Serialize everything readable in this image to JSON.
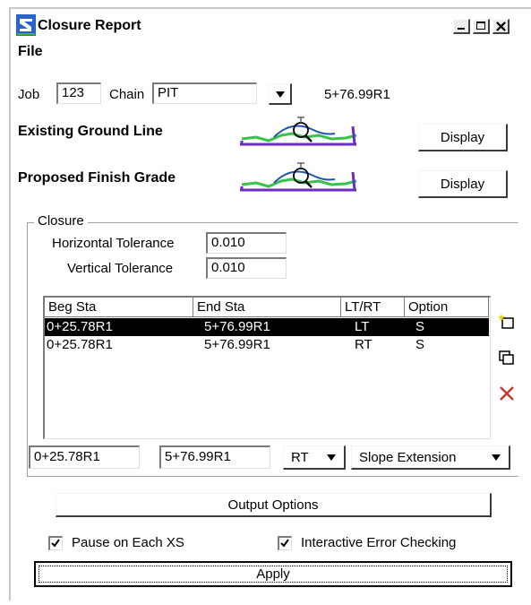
{
  "window": {
    "title": "Closure Report"
  },
  "menu": {
    "file": "File"
  },
  "job": {
    "label": "Job",
    "value": "123"
  },
  "chain": {
    "label": "Chain",
    "value": "PIT",
    "station": "5+76.99R1"
  },
  "existing": {
    "label": "Existing Ground Line",
    "display_label": "Display"
  },
  "proposed": {
    "label": "Proposed Finish Grade",
    "display_label": "Display"
  },
  "closure": {
    "group_label": "Closure",
    "horizontal_label": "Horizontal Tolerance",
    "horizontal_value": "0.010",
    "vertical_label": "Vertical Tolerance",
    "vertical_value": "0.010"
  },
  "list": {
    "columns": [
      "Beg Sta",
      "End Sta",
      "LT/RT",
      "Option"
    ],
    "rows": [
      {
        "beg": "0+25.78R1",
        "end": "5+76.99R1",
        "side": "LT",
        "option": "S",
        "selected": true
      },
      {
        "beg": "0+25.78R1",
        "end": "5+76.99R1",
        "side": "RT",
        "option": "S",
        "selected": false
      }
    ]
  },
  "edit": {
    "beg": "0+25.78R1",
    "end": "5+76.99R1",
    "side": "RT",
    "option": "Slope Extension"
  },
  "buttons": {
    "output_options": "Output Options",
    "apply": "Apply"
  },
  "checks": {
    "pause_label": "Pause on Each XS",
    "pause_checked": true,
    "error_label": "Interactive Error Checking",
    "error_checked": true
  },
  "colors": {
    "accent": "#1f5fbf",
    "delete": "#c0392b"
  }
}
